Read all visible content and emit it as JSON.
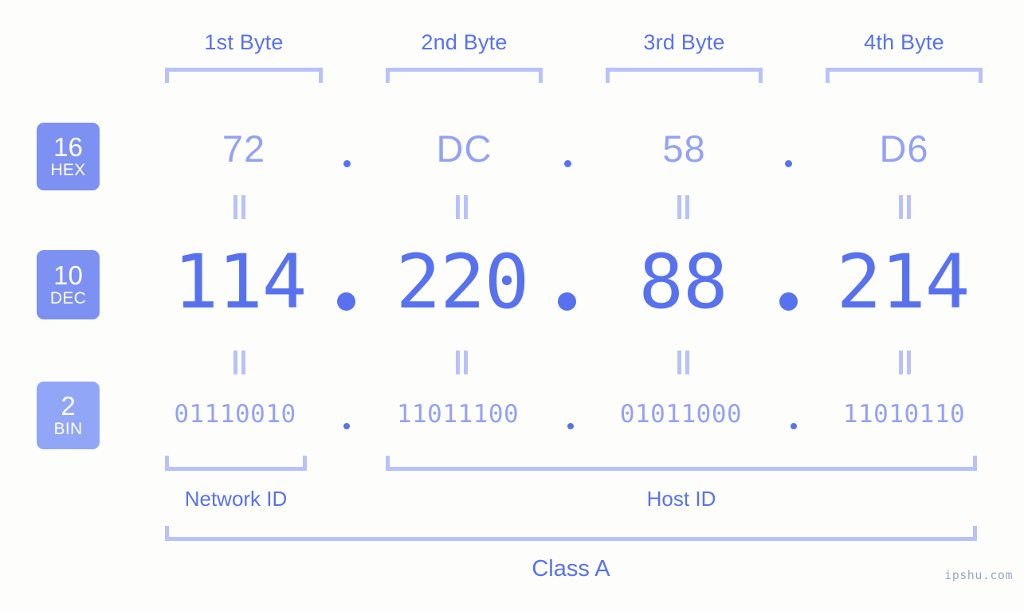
{
  "background_color": "#fdfefb",
  "colors": {
    "accent_strong": "#5872ef",
    "accent_light": "#93a2f5",
    "bracket": "#b8c2fa",
    "badge_hex": "#7d91f2",
    "badge_dec": "#7d91f2",
    "badge_bin": "#92a6f7",
    "badge_text": "#ffffff",
    "watermark": "#9aa6c4"
  },
  "byte_headers": [
    {
      "label": "1st Byte"
    },
    {
      "label": "2nd Byte"
    },
    {
      "label": "3rd Byte"
    },
    {
      "label": "4th Byte"
    }
  ],
  "radix_badges": [
    {
      "number": "16",
      "name": "HEX"
    },
    {
      "number": "10",
      "name": "DEC"
    },
    {
      "number": "2",
      "name": "BIN"
    }
  ],
  "rows": {
    "hex": {
      "radix": "16",
      "radix_name": "HEX",
      "values": [
        "72",
        "DC",
        "58",
        "D6"
      ],
      "separator": "."
    },
    "dec": {
      "radix": "10",
      "radix_name": "DEC",
      "values": [
        "114",
        "220",
        "88",
        "214"
      ],
      "separator": "."
    },
    "bin": {
      "radix": "2",
      "radix_name": "BIN",
      "values": [
        "01110010",
        "11011100",
        "01011000",
        "11010110"
      ],
      "separator": "."
    }
  },
  "equals_symbol": "=",
  "ip_address": "114.220.88.214",
  "segments": [
    {
      "label": "Network ID"
    },
    {
      "label": "Host ID"
    }
  ],
  "class": {
    "label": "Class A"
  },
  "watermark": {
    "text": "ipshu.com"
  }
}
